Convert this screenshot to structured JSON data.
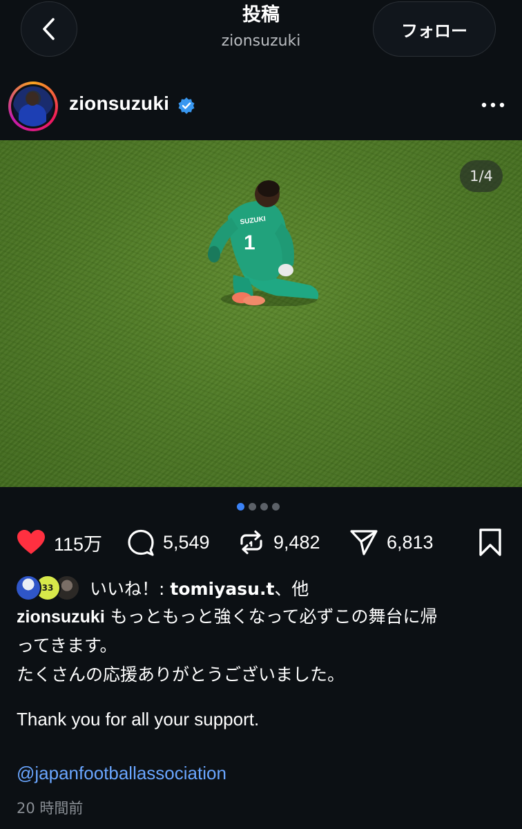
{
  "header": {
    "title": "投稿",
    "subtitle": "zionsuzuki",
    "follow_label": "フォロー"
  },
  "post": {
    "username": "zionsuzuki",
    "verified": true,
    "image_counter": "1/4",
    "carousel": {
      "total": 4,
      "active_index": 0
    },
    "stats": {
      "likes": "115万",
      "comments": "5,549",
      "reposts": "9,482",
      "shares": "6,813"
    },
    "liked_by": {
      "prefix": "いいね！: ",
      "user": "tomiyasu.t",
      "suffix": "、他",
      "avatar_badge": "33"
    },
    "caption": {
      "user": "zionsuzuki",
      "line1": "もっともっと強くなって必ずこの舞台に帰",
      "line2": "ってきます。",
      "line3": "たくさんの応援ありがとうございました。",
      "english": "Thank you for all your support.",
      "mention": "@japanfootballassociation"
    },
    "timestamp": "20 時間前"
  },
  "colors": {
    "background": "#0c1014",
    "like_red": "#ff3040",
    "link_blue": "#6aa6ff",
    "verified_blue": "#3897f0",
    "dot_active": "#3b82f6"
  },
  "icons": {
    "back": "chevron-left-icon",
    "verified": "verified-badge-icon",
    "more": "more-horizontal-icon",
    "like": "heart-icon",
    "comment": "comment-icon",
    "repost": "repost-icon",
    "share": "send-icon",
    "save": "bookmark-icon"
  }
}
